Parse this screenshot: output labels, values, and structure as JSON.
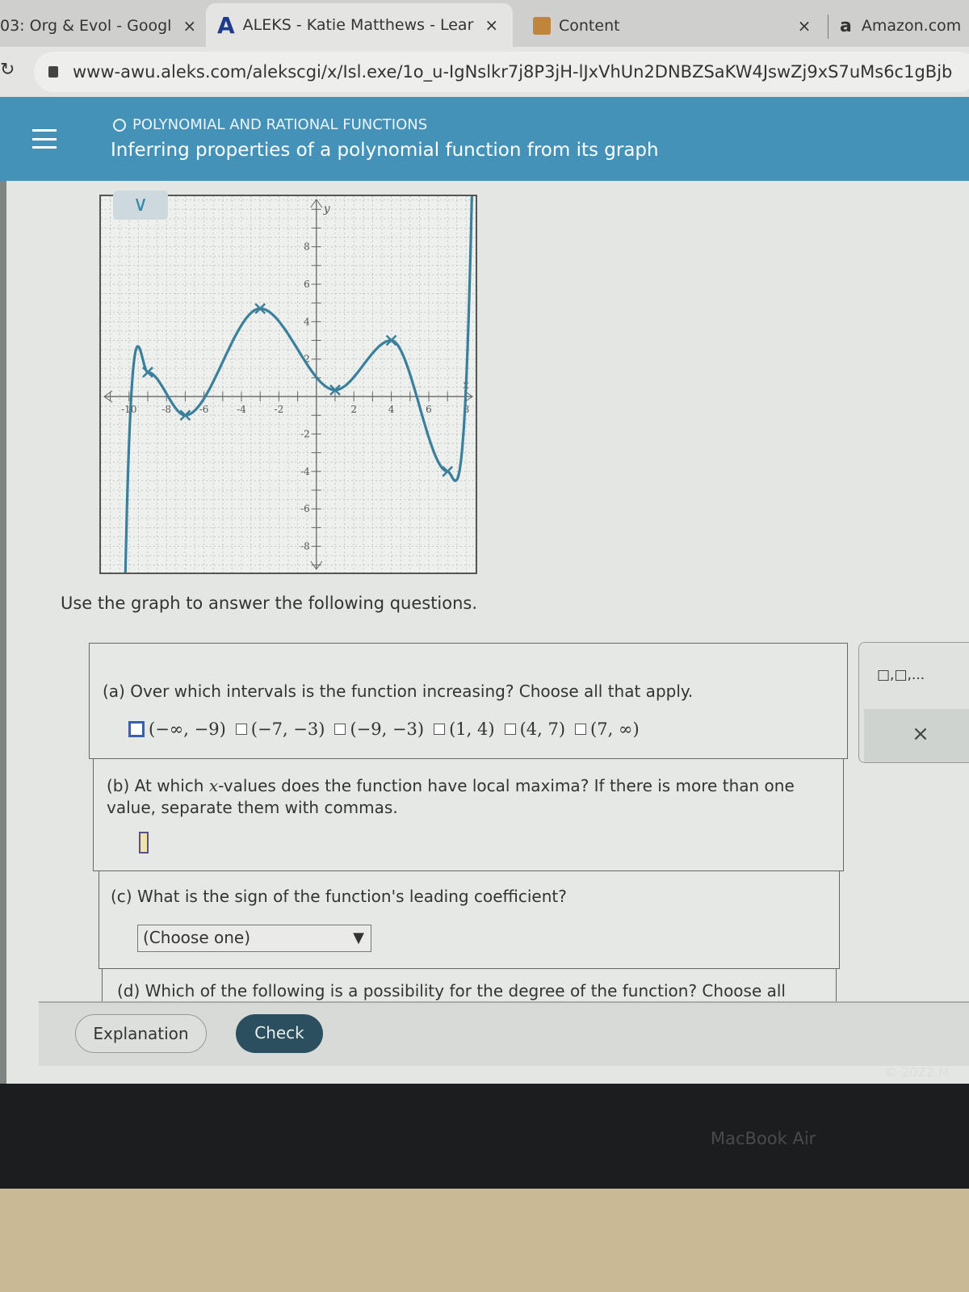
{
  "browser": {
    "tabs": [
      {
        "label": "03: Org & Evol - Googl",
        "icon": "google-docs-icon"
      },
      {
        "label": "ALEKS - Katie Matthews - Lear",
        "icon": "aleks-logo-icon",
        "active": true
      },
      {
        "label": "Content",
        "icon": "pencil-icon"
      },
      {
        "label": "Amazon.com",
        "icon": "amazon-logo-icon"
      }
    ],
    "close_glyph": "×",
    "url": "www-awu.aleks.com/alekscgi/x/Isl.exe/1o_u-IgNslkr7j8P3jH-lJxVhUn2DNBZSaKW4JswZj9xS7uMs6c1gBjb"
  },
  "header": {
    "topic": "POLYNOMIAL AND RATIONAL FUNCTIONS",
    "title": "Inferring properties of a polynomial function from its graph",
    "color": "#4592b8"
  },
  "graph": {
    "x_label": "x",
    "y_label": "y",
    "x_ticks": [
      "-10",
      "-8",
      "-6",
      "-4",
      "-2",
      "2",
      "4",
      "6",
      "8"
    ],
    "y_ticks": [
      "8",
      "6",
      "4",
      "2",
      "-2",
      "-4",
      "-6",
      "-8"
    ],
    "x_range": [
      -11.5,
      8.5
    ],
    "y_range": [
      -9.4,
      10.7
    ],
    "turning_points": [
      {
        "x": -9,
        "y": 1.3,
        "type": "max"
      },
      {
        "x": -7,
        "y": -1,
        "type": "min"
      },
      {
        "x": -3,
        "y": 4.7,
        "type": "max"
      },
      {
        "x": 1,
        "y": 0.35,
        "type": "min"
      },
      {
        "x": 4,
        "y": 3,
        "type": "max"
      },
      {
        "x": 7,
        "y": -4,
        "type": "min"
      }
    ],
    "curve_color": "#3a7f9c",
    "collapse_glyph": "∨"
  },
  "instructions": "Use the graph to answer the following questions.",
  "questions": {
    "a": {
      "prompt": "(a) Over which intervals is the function increasing? Choose all that apply.",
      "options": [
        "(−∞, −9)",
        "(−7, −3)",
        "(−9, −3)",
        "(1, 4)",
        "(4, 7)",
        "(7, ∞)"
      ]
    },
    "b": {
      "prompt_1": "(b) At which ",
      "prompt_var": "x",
      "prompt_2": "-values does the function have local maxima? If there is more than one value, separate them with commas.",
      "value": ""
    },
    "c": {
      "prompt": "(c) What is the sign of the function's leading coefficient?",
      "select_value": "(Choose one)",
      "arrow": "▼"
    },
    "d": {
      "prompt": "(d) Which of the following is a possibility for the degree of the function? Choose all"
    }
  },
  "side_panel": {
    "template_label": "□,□,...",
    "clear_glyph": "×"
  },
  "buttons": {
    "explanation": "Explanation",
    "check": "Check"
  },
  "footer": {
    "copyright": "© 2022 M"
  },
  "device": {
    "label": "MacBook Air"
  }
}
